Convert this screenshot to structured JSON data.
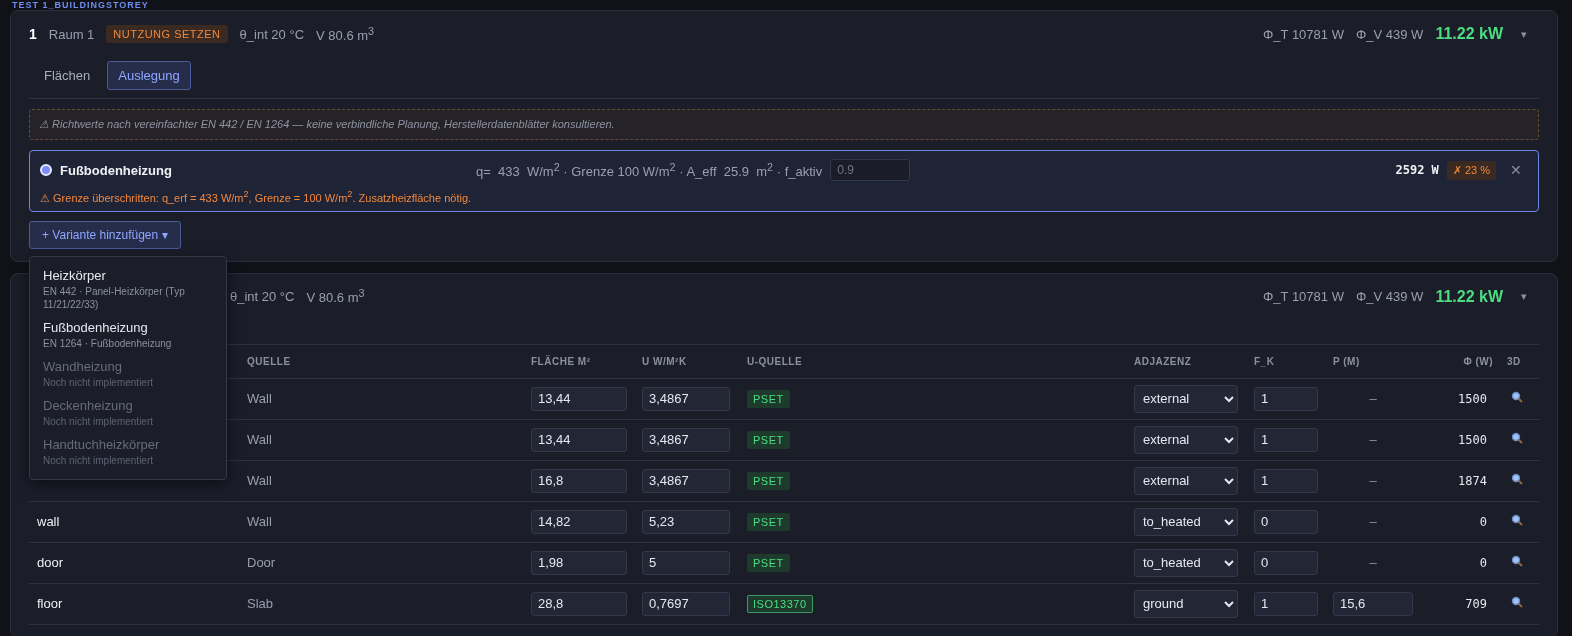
{
  "storey": {
    "title": "TEST 1_BUILDINGSTOREY"
  },
  "rooms": [
    {
      "number": "1",
      "name": "Raum 1",
      "usage_badge": "NUTZUNG SETZEN",
      "theta": "θ_int 20 °C",
      "volume": "V 80.6 m$^{3}$",
      "phi_t": "Φ_T 10781 W",
      "phi_v": "Φ_V 439 W",
      "total": "11.22 kW",
      "toggle": "▾",
      "tabs": [
        {
          "label": "Flächen",
          "selected": false
        },
        {
          "label": "Auslegung",
          "selected": true
        }
      ],
      "notice": "⚠ Richtwerte nach vereinfachter EN 442 / EN 1264 — keine verbindliche Planung, Herstellerdatenblätter konsultieren.",
      "variants": [
        {
          "name": "Fußbodenheizung",
          "selected": true,
          "params": "q=  433  W/m$^{2}$ · Grenze 100 W/m$^{2}$ · A_eff  25.9  m$^{2}$ · f_aktiv",
          "f_aktiv_placeholder": "0.9",
          "power": "2592 W",
          "coverage": "✗ 23 %",
          "remove": "✕",
          "warning": "⚠ Grenze überschritten: q_erf = 433 W/m$^{2}$, Grenze = 100 W/m$^{2}$. Zusatzheizfläche nötig."
        }
      ],
      "add_button": "+ Variante hinzufügen ▾",
      "add_menu": [
        {
          "title": "Heizkörper",
          "subtitle": "EN 442 · Panel-Heizkörper (Typ 11/21/22/33)",
          "disabled": false
        },
        {
          "title": "Fußbodenheizung",
          "subtitle": "EN 1264 · Fußbodenheizung",
          "disabled": false
        },
        {
          "title": "Wandheizung",
          "subtitle": "Noch nicht implementiert",
          "disabled": true
        },
        {
          "title": "Deckenheizung",
          "subtitle": "Noch nicht implementiert",
          "disabled": true
        },
        {
          "title": "Handtuchheizkörper",
          "subtitle": "Noch nicht implementiert",
          "disabled": true
        }
      ]
    },
    {
      "theta": "θ_int 20 °C",
      "volume": "V 80.6 m$^{3}$",
      "phi_t": "Φ_T 10781 W",
      "phi_v": "Φ_V 439 W",
      "total": "11.22 kW",
      "toggle": "▾",
      "table": {
        "columns": [
          "QUELLE",
          "FLÄCHE M²",
          "U W/M²K",
          "U-QUELLE",
          "ADJAZENZ",
          "F_K",
          "P (M)",
          "Φ (W)",
          "3D"
        ],
        "rows": [
          {
            "quelle": "Wall",
            "flaeche": "13,44",
            "u": "3,4867",
            "u_quelle": {
              "label": "PSET",
              "kind": "plain"
            },
            "adjazenz": "external",
            "f_k": "1",
            "p": {
              "kind": "text",
              "value": "–"
            },
            "phi": "1500"
          },
          {
            "quelle": "Wall",
            "flaeche": "13,44",
            "u": "3,4867",
            "u_quelle": {
              "label": "PSET",
              "kind": "plain"
            },
            "adjazenz": "external",
            "f_k": "1",
            "p": {
              "kind": "text",
              "value": "–"
            },
            "phi": "1500"
          },
          {
            "quelle": "Wall",
            "flaeche": "16,8",
            "u": "3,4867",
            "u_quelle": {
              "label": "PSET",
              "kind": "plain"
            },
            "adjazenz": "external",
            "f_k": "1",
            "p": {
              "kind": "text",
              "value": "–"
            },
            "phi": "1874"
          },
          {
            "name": "wall",
            "quelle": "Wall",
            "flaeche": "14,82",
            "u": "5,23",
            "u_quelle": {
              "label": "PSET",
              "kind": "plain"
            },
            "adjazenz": "to_heated",
            "f_k": "0",
            "p": {
              "kind": "text",
              "value": "–"
            },
            "phi": "0"
          },
          {
            "name": "door",
            "quelle": "Door",
            "flaeche": "1,98",
            "u": "5",
            "u_quelle": {
              "label": "PSET",
              "kind": "plain"
            },
            "adjazenz": "to_heated",
            "f_k": "0",
            "p": {
              "kind": "text",
              "value": "–"
            },
            "phi": "0"
          },
          {
            "name": "floor",
            "quelle": "Slab",
            "flaeche": "28,8",
            "u": "0,7697",
            "u_quelle": {
              "label": "ISO13370",
              "kind": "outlined"
            },
            "adjazenz": "ground",
            "f_k": "1",
            "p": {
              "kind": "input",
              "value": "15,6"
            },
            "phi": "709"
          }
        ]
      }
    }
  ]
}
